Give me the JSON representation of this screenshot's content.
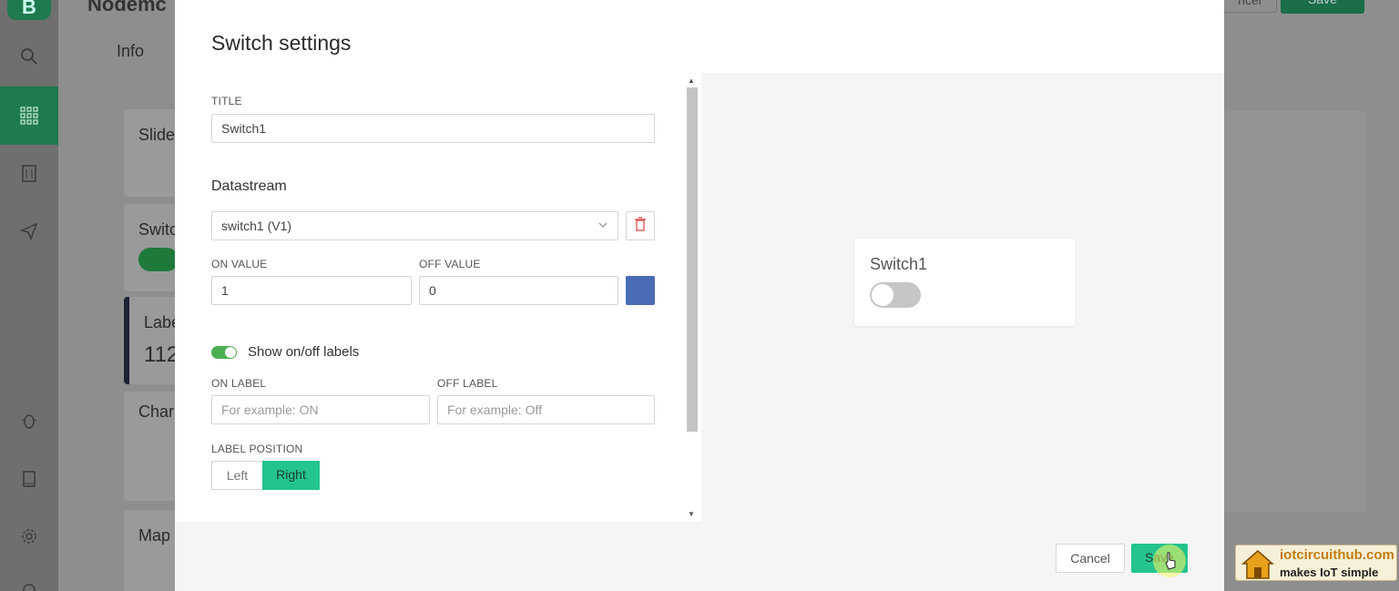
{
  "background_app": {
    "title": "Nodemc",
    "info_tab": "Info",
    "cancel_label": "ncel",
    "save_label": "Save",
    "cards": [
      "Slide",
      "Switc",
      "Labe",
      "Char",
      "Map"
    ],
    "label_value": "112"
  },
  "sidebar": {
    "logo": "B",
    "items": [
      {
        "icon": "search-icon"
      },
      {
        "icon": "dashboard-grid-icon"
      },
      {
        "icon": "building-icon"
      },
      {
        "icon": "send-icon"
      },
      {
        "icon": "bug-icon"
      },
      {
        "icon": "book-icon"
      },
      {
        "icon": "gear-icon"
      },
      {
        "icon": "help-icon"
      }
    ]
  },
  "modal": {
    "title": "Switch settings",
    "form": {
      "title_label": "TITLE",
      "title_value": "Switch1",
      "datastream_heading": "Datastream",
      "datastream_value": "switch1 (V1)",
      "on_value_label": "ON VALUE",
      "on_value": "1",
      "off_value_label": "OFF VALUE",
      "off_value": "0",
      "color_swatch": "#4a6bb5",
      "show_labels_text": "Show on/off labels",
      "show_labels_enabled": true,
      "on_label_label": "ON LABEL",
      "on_label_placeholder": "For example: ON",
      "off_label_label": "OFF LABEL",
      "off_label_placeholder": "For example: Off",
      "label_position_label": "LABEL POSITION",
      "position_left": "Left",
      "position_right": "Right",
      "position_selected": "Right"
    },
    "preview": {
      "widget_title": "Switch1",
      "switch_state": "off"
    },
    "footer": {
      "cancel": "Cancel",
      "save": "Save"
    }
  },
  "watermark": {
    "line1": "iotcircuithub.com",
    "line2": "makes IoT simple"
  },
  "colors": {
    "accent": "#23c48e",
    "brand_dark": "#1e7a4f",
    "toggle_on": "#4caf50"
  }
}
